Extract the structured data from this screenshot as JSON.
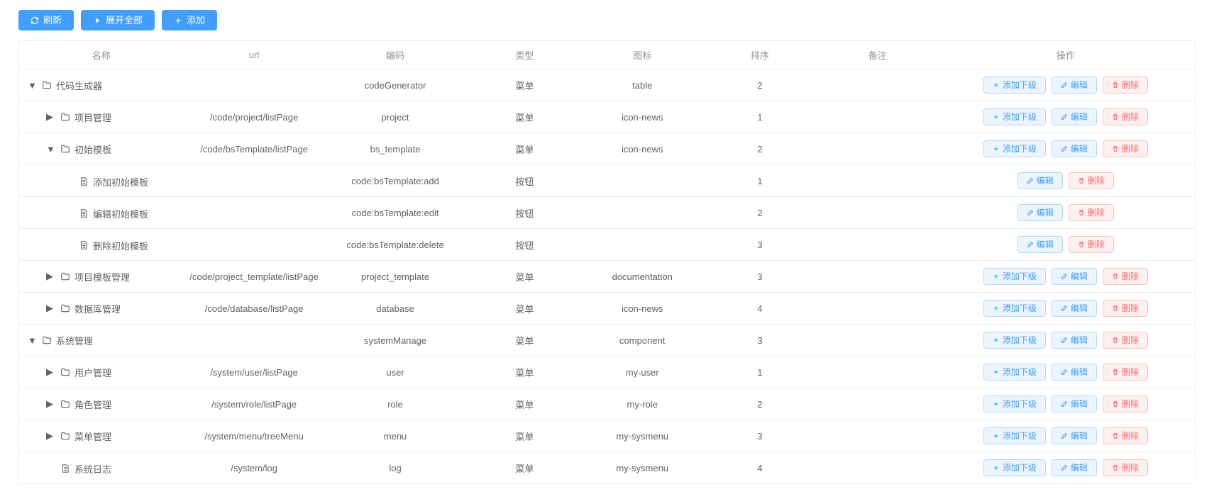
{
  "toolbar": {
    "refresh": "刷新",
    "expand_all": "展开全部",
    "add": "添加"
  },
  "columns": {
    "name": "名称",
    "url": "url",
    "code": "编码",
    "type": "类型",
    "icon": "图标",
    "sort": "排序",
    "remark": "备注",
    "operation": "操作"
  },
  "type_labels": {
    "menu": "菜单",
    "button": "按钮"
  },
  "op_labels": {
    "add_child": "添加下级",
    "edit": "编辑",
    "delete": "删除"
  },
  "rows": [
    {
      "level": 0,
      "toggle": "down",
      "icon": "folder",
      "name": "代码生成器",
      "url": "",
      "code": "codeGenerator",
      "type": "menu",
      "icon_name": "table",
      "sort": "2",
      "remark": "",
      "ops": [
        "add_child",
        "edit",
        "delete"
      ]
    },
    {
      "level": 1,
      "toggle": "right",
      "icon": "folder",
      "name": "项目管理",
      "url": "/code/project/listPage",
      "code": "project",
      "type": "menu",
      "icon_name": "icon-news",
      "sort": "1",
      "remark": "",
      "ops": [
        "add_child",
        "edit",
        "delete"
      ]
    },
    {
      "level": 1,
      "toggle": "down",
      "icon": "folder",
      "name": "初始模板",
      "url": "/code/bsTemplate/listPage",
      "code": "bs_template",
      "type": "menu",
      "icon_name": "icon-news",
      "sort": "2",
      "remark": "",
      "ops": [
        "add_child",
        "edit",
        "delete"
      ]
    },
    {
      "level": 2,
      "toggle": "none",
      "icon": "file",
      "name": "添加初始模板",
      "url": "",
      "code": "code:bsTemplate:add",
      "type": "button",
      "icon_name": "",
      "sort": "1",
      "remark": "",
      "ops": [
        "edit",
        "delete"
      ]
    },
    {
      "level": 2,
      "toggle": "none",
      "icon": "file",
      "name": "编辑初始模板",
      "url": "",
      "code": "code:bsTemplate:edit",
      "type": "button",
      "icon_name": "",
      "sort": "2",
      "remark": "",
      "ops": [
        "edit",
        "delete"
      ]
    },
    {
      "level": 2,
      "toggle": "none",
      "icon": "file",
      "name": "删除初始模板",
      "url": "",
      "code": "code:bsTemplate:delete",
      "type": "button",
      "icon_name": "",
      "sort": "3",
      "remark": "",
      "ops": [
        "edit",
        "delete"
      ]
    },
    {
      "level": 1,
      "toggle": "right",
      "icon": "folder",
      "name": "项目模板管理",
      "url": "/code/project_template/listPage",
      "code": "project_template",
      "type": "menu",
      "icon_name": "documentation",
      "sort": "3",
      "remark": "",
      "ops": [
        "add_child",
        "edit",
        "delete"
      ]
    },
    {
      "level": 1,
      "toggle": "right",
      "icon": "folder",
      "name": "数据库管理",
      "url": "/code/database/listPage",
      "code": "database",
      "type": "menu",
      "icon_name": "icon-news",
      "sort": "4",
      "remark": "",
      "ops": [
        "add_child",
        "edit",
        "delete"
      ]
    },
    {
      "level": 0,
      "toggle": "down",
      "icon": "folder",
      "name": "系统管理",
      "url": "",
      "code": "systemManage",
      "type": "menu",
      "icon_name": "component",
      "sort": "3",
      "remark": "",
      "ops": [
        "add_child",
        "edit",
        "delete"
      ]
    },
    {
      "level": 1,
      "toggle": "right",
      "icon": "folder",
      "name": "用户管理",
      "url": "/system/user/listPage",
      "code": "user",
      "type": "menu",
      "icon_name": "my-user",
      "sort": "1",
      "remark": "",
      "ops": [
        "add_child",
        "edit",
        "delete"
      ]
    },
    {
      "level": 1,
      "toggle": "right",
      "icon": "folder",
      "name": "角色管理",
      "url": "/system/role/listPage",
      "code": "role",
      "type": "menu",
      "icon_name": "my-role",
      "sort": "2",
      "remark": "",
      "ops": [
        "add_child",
        "edit",
        "delete"
      ]
    },
    {
      "level": 1,
      "toggle": "right",
      "icon": "folder",
      "name": "菜单管理",
      "url": "/system/menu/treeMenu",
      "code": "menu",
      "type": "menu",
      "icon_name": "my-sysmenu",
      "sort": "3",
      "remark": "",
      "ops": [
        "add_child",
        "edit",
        "delete"
      ]
    },
    {
      "level": 1,
      "toggle": "none",
      "icon": "file",
      "name": "系统日志",
      "url": "/system/log",
      "code": "log",
      "type": "menu",
      "icon_name": "my-sysmenu",
      "sort": "4",
      "remark": "",
      "ops": [
        "add_child",
        "edit",
        "delete"
      ]
    }
  ]
}
